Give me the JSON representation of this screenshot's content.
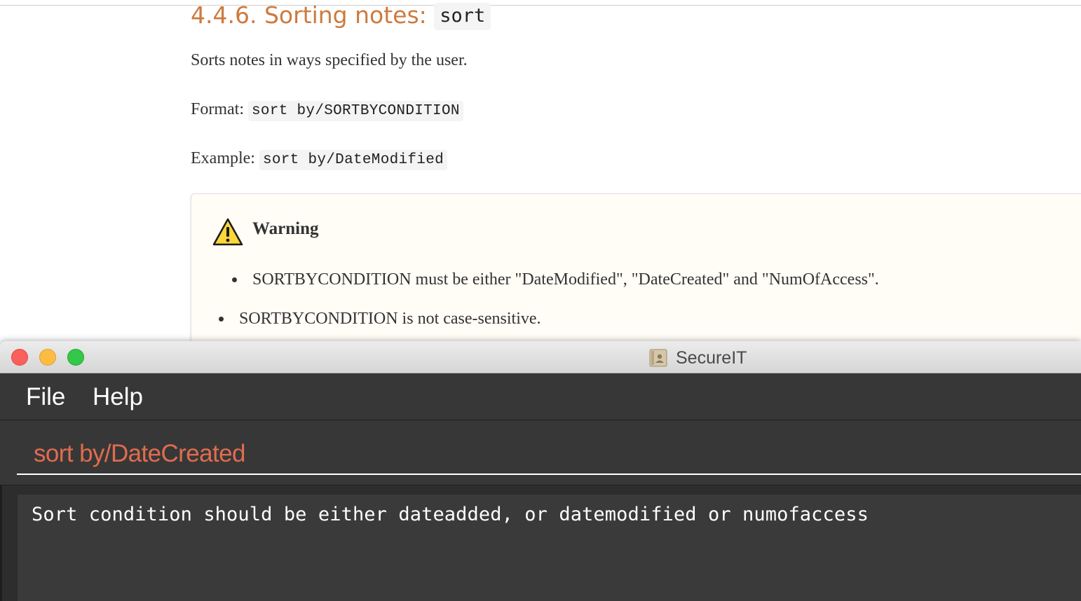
{
  "doc": {
    "heading_number": "4.4.6. Sorting notes:",
    "heading_code": "sort",
    "description": "Sorts notes in ways specified by the user.",
    "format_label": "Format:",
    "format_code": "sort by/SORTBYCONDITION",
    "example_label": "Example:",
    "example_code": "sort by/DateModified",
    "warning": {
      "title": "Warning",
      "icon": "warning-triangle-icon",
      "bullets": [
        "SORTBYCONDITION must be either \"DateModified\", \"DateCreated\" and \"NumOfAccess\".",
        "SORTBYCONDITION is not case-sensitive."
      ]
    }
  },
  "app": {
    "window_title": "SecureIT",
    "menu": {
      "file": "File",
      "help": "Help"
    },
    "command_input_value": "sort by/DateCreated",
    "result_text": "Sort condition should be either dateadded, or datemodified or numofaccess",
    "colors": {
      "command_text": "#e06c4f",
      "background": "#2d2d2d",
      "doc_heading": "#ce7a3d"
    }
  }
}
